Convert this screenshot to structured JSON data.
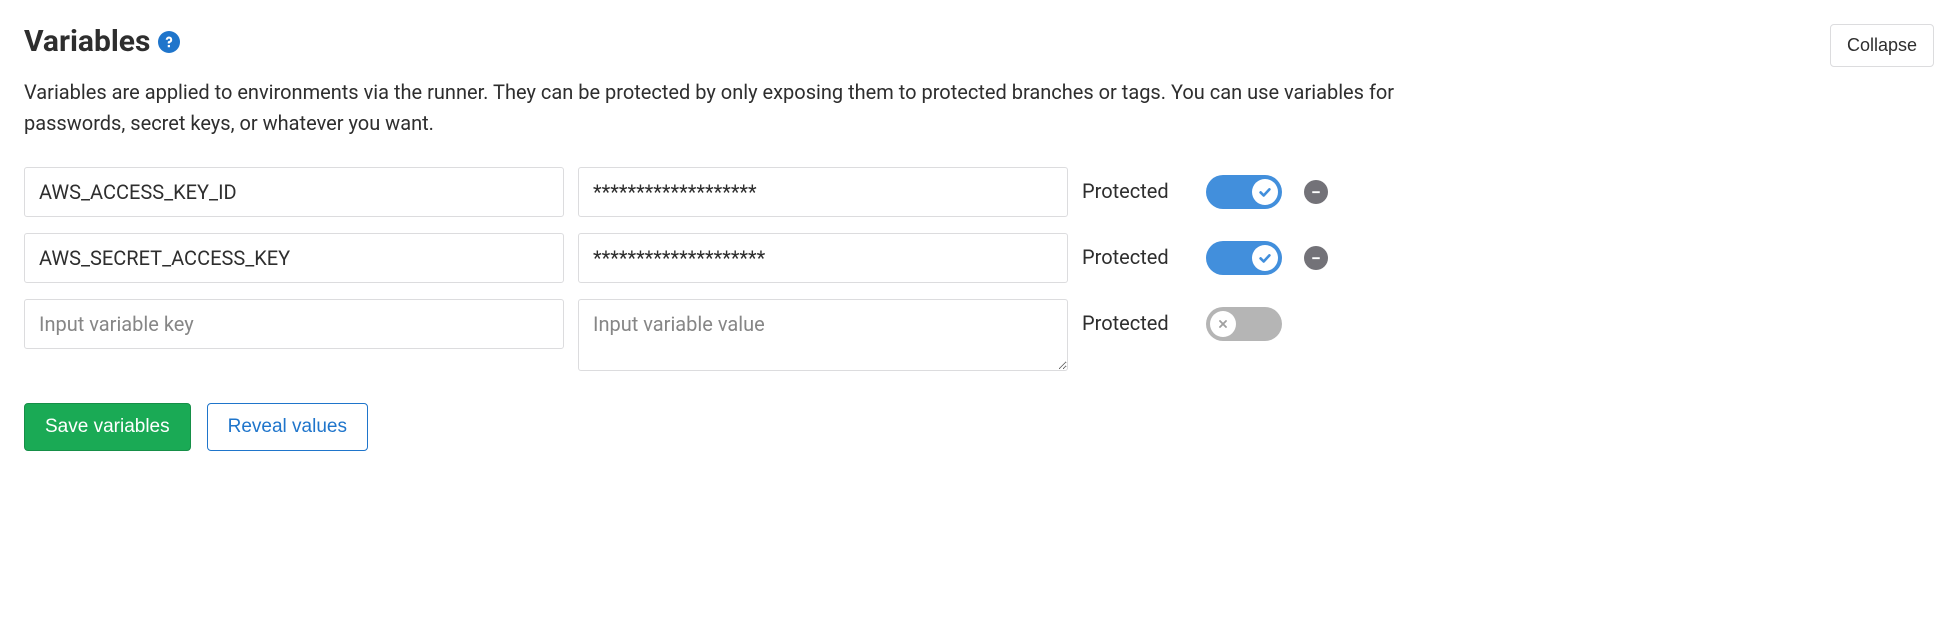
{
  "header": {
    "title": "Variables",
    "collapse_label": "Collapse"
  },
  "description": "Variables are applied to environments via the runner. They can be protected by only exposing them to protected branches or tags. You can use variables for passwords, secret keys, or whatever you want.",
  "protected_label": "Protected",
  "rows": [
    {
      "key": "AWS_ACCESS_KEY_ID",
      "value": "*******************",
      "protected": true
    },
    {
      "key": "AWS_SECRET_ACCESS_KEY",
      "value": "********************",
      "protected": true
    }
  ],
  "new_row": {
    "key_placeholder": "Input variable key",
    "value_placeholder": "Input variable value",
    "protected": false
  },
  "buttons": {
    "save": "Save variables",
    "reveal": "Reveal values"
  }
}
